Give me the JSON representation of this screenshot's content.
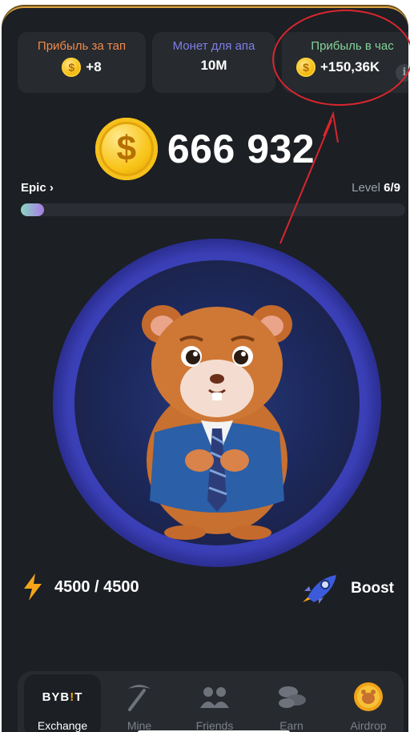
{
  "stats": {
    "per_tap": {
      "label": "Прибыль за тап",
      "value": "+8",
      "icon": "coin-icon",
      "color": "#f08a4b"
    },
    "to_level_up": {
      "label": "Монет для апа",
      "value": "10M",
      "color": "#7f7ee8"
    },
    "per_hour": {
      "label": "Прибыль в час",
      "value": "+150,36K",
      "icon": "coin-icon",
      "info": "i",
      "color": "#85d39a"
    }
  },
  "balance": {
    "value": "666 932",
    "coin_symbol": "$"
  },
  "league": {
    "name": "Epic",
    "chevron": "›"
  },
  "level": {
    "label": "Level",
    "current_total": "6/9",
    "progress": 0.06
  },
  "tap_target": {
    "icon": "hamster-ceo-icon"
  },
  "energy": {
    "value": "4500 / 4500",
    "icon": "lightning-icon"
  },
  "boost": {
    "label": "Boost",
    "icon": "rocket-icon"
  },
  "nav": {
    "items": [
      {
        "label": "Exchange",
        "icon": "bybit-logo",
        "logo_text": "BYB",
        "logo_bang": "!",
        "logo_end": "T",
        "active": true
      },
      {
        "label": "Mine",
        "icon": "pickaxe-icon"
      },
      {
        "label": "Friends",
        "icon": "friends-icon"
      },
      {
        "label": "Earn",
        "icon": "coins-stack-icon"
      },
      {
        "label": "Airdrop",
        "icon": "airdrop-coin-icon"
      }
    ]
  },
  "colors": {
    "background": "#1c1f24",
    "card": "#272a2f",
    "accent_gold": "#f5b90b",
    "annotation_red": "#d8262e",
    "circle_blue": "#3a3fb6"
  }
}
